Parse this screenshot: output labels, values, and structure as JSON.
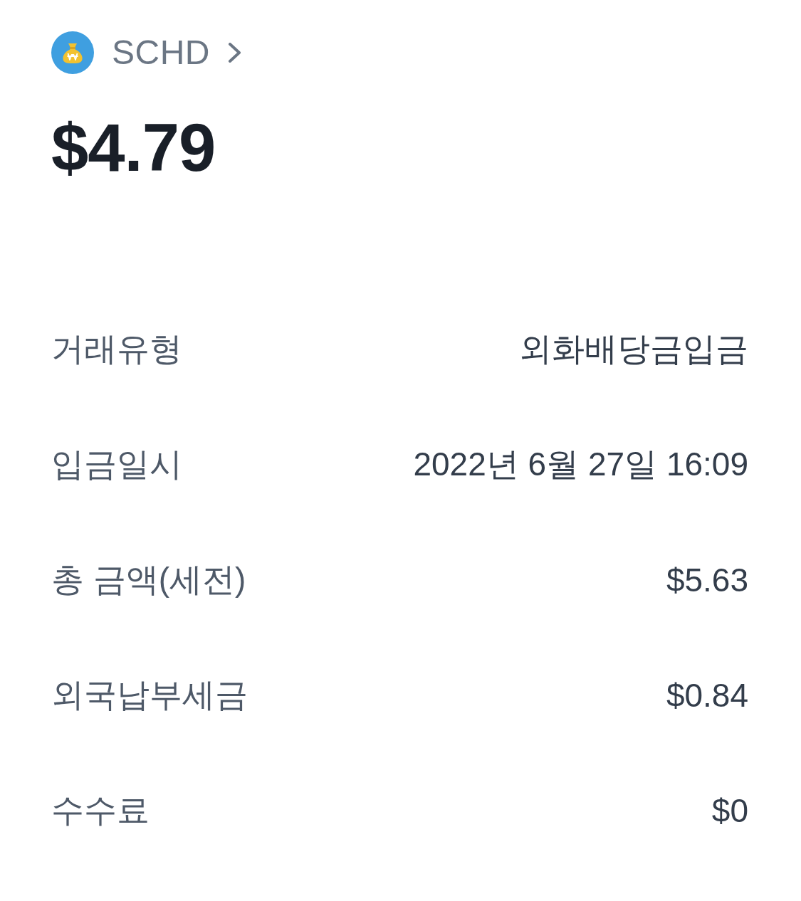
{
  "header": {
    "name": "SCHD"
  },
  "amount": "$4.79",
  "details": [
    {
      "label": "거래유형",
      "value": "외화배당금입금"
    },
    {
      "label": "입금일시",
      "value": "2022년 6월 27일 16:09"
    },
    {
      "label": "총 금액(세전)",
      "value": "$5.63"
    },
    {
      "label": "외국납부세금",
      "value": "$0.84"
    },
    {
      "label": "수수료",
      "value": "$0"
    }
  ]
}
